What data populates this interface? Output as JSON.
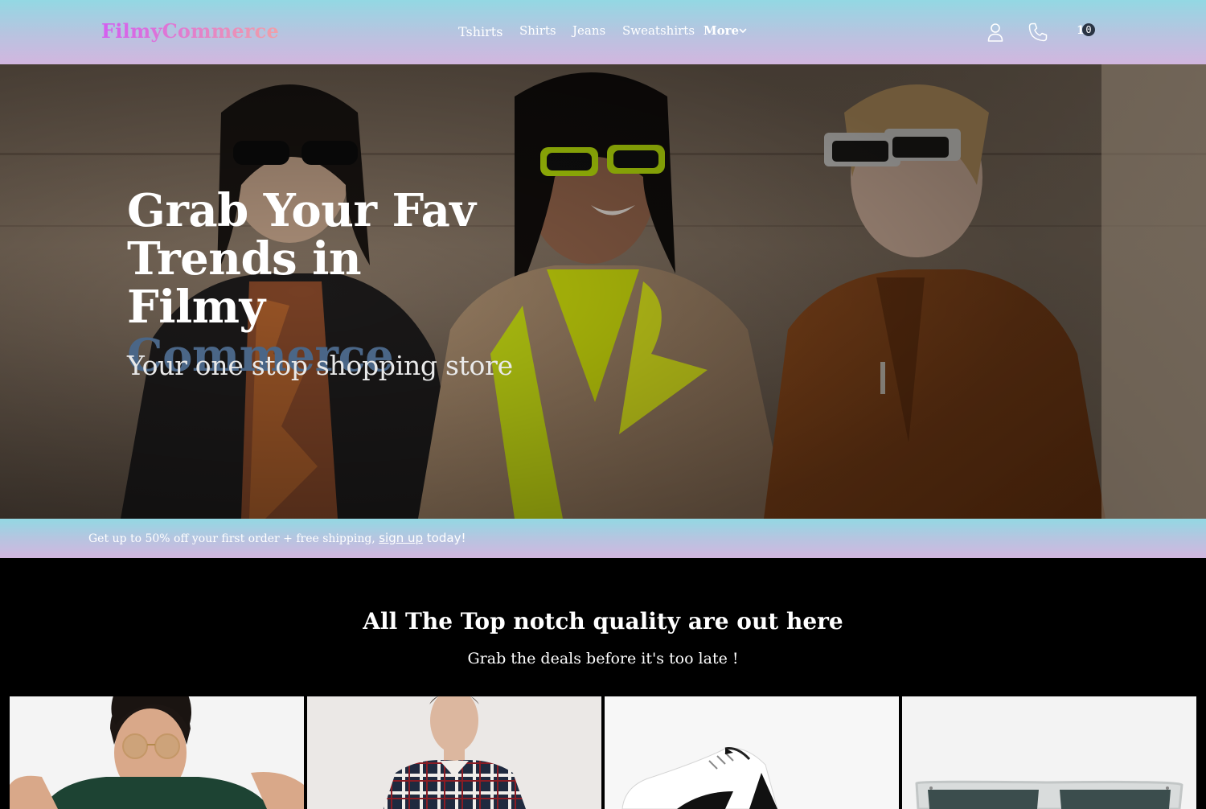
{
  "header": {
    "logo_part1": "Filmy",
    "logo_part2": "Commerce",
    "nav": [
      "Tshirts",
      "Shirts",
      "Jeans",
      "Sweatshirts",
      "More"
    ],
    "icons": [
      "user-icon",
      "phone-icon",
      "cart-icon",
      "chevron-down-icon"
    ],
    "cart_count": "0"
  },
  "hero": {
    "title_line1": "Grab Your Fav",
    "title_line2": "Trends in",
    "title_line3_plain": "Filmy ",
    "title_line3_accent": "Commerce",
    "subtitle": "Your one stop shopping store"
  },
  "promo": {
    "text": "Get up to 50% off your first order + free shipping, ",
    "link": "sign up",
    "after": " today!"
  },
  "section": {
    "title": "All The Top notch quality are out here",
    "subtitle": "Grab the deals before it's too late !"
  },
  "colors": {
    "header_gradient_top": "#93d8e3",
    "header_gradient_bottom": "#d2b6df",
    "logo_gradient_start": "#d35ef0",
    "logo_gradient_end": "#f0a0a8",
    "hero_accent": "#4a6687",
    "section_bg": "#000000"
  }
}
